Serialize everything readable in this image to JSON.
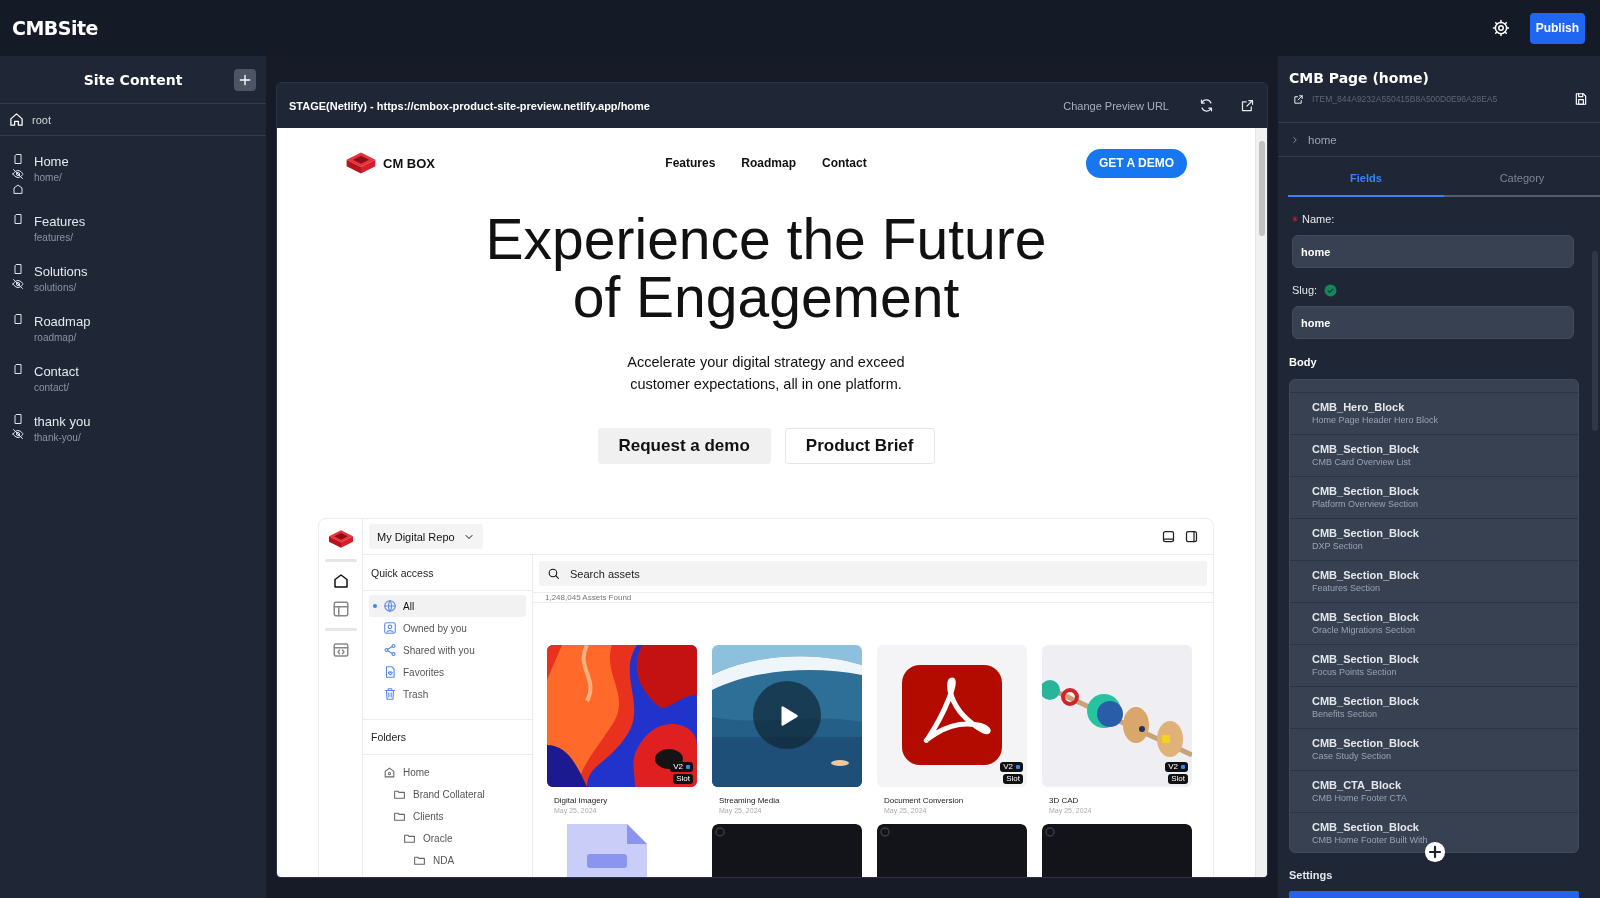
{
  "app": {
    "title": "CMBSite",
    "publish": "Publish"
  },
  "sidebar": {
    "title": "Site Content",
    "root": "root",
    "items": [
      {
        "name": "Home",
        "path": "home/",
        "hidden": true,
        "is_home": true
      },
      {
        "name": "Features",
        "path": "features/",
        "hidden": false,
        "is_home": false
      },
      {
        "name": "Solutions",
        "path": "solutions/",
        "hidden": true,
        "is_home": false
      },
      {
        "name": "Roadmap",
        "path": "roadmap/",
        "hidden": false,
        "is_home": false
      },
      {
        "name": "Contact",
        "path": "contact/",
        "hidden": false,
        "is_home": false
      },
      {
        "name": "thank you",
        "path": "thank-you/",
        "hidden": true,
        "is_home": false
      }
    ]
  },
  "preview": {
    "url_label": "STAGE(Netlify) - https://cmbox-product-site-preview.netlify.app/home",
    "change_url": "Change Preview URL",
    "site": {
      "brand": "CM BOX",
      "nav": [
        "Features",
        "Roadmap",
        "Contact"
      ],
      "cta": "GET A DEMO",
      "headline": "Experience the Future of Engagement",
      "subtext": "Accelerate your digital strategy and exceed customer expectations, all in one platform.",
      "buttons": [
        {
          "label": "Request a demo",
          "kind": "filled"
        },
        {
          "label": "Product Brief",
          "kind": "outline"
        }
      ],
      "mockup": {
        "repo": "My Digital Repo",
        "quick_access_title": "Quick access",
        "quick_access": [
          {
            "label": "All",
            "selected": true
          },
          {
            "label": "Owned by you",
            "selected": false
          },
          {
            "label": "Shared with you",
            "selected": false
          },
          {
            "label": "Favorites",
            "selected": false
          },
          {
            "label": "Trash",
            "selected": false
          }
        ],
        "folders_title": "Folders",
        "folders": [
          {
            "label": "Home",
            "kind": "home",
            "children": [
              {
                "label": "Brand Collateral",
                "kind": "folder"
              },
              {
                "label": "Clients",
                "kind": "folder",
                "children": [
                  {
                    "label": "Oracle",
                    "kind": "folder",
                    "children": [
                      {
                        "label": "NDA",
                        "kind": "folder"
                      }
                    ]
                  }
                ]
              }
            ]
          }
        ],
        "search_placeholder": "Search assets",
        "count": "1,248,045 Assets Found",
        "assets": [
          {
            "title": "Digital Imagery",
            "date": "May 25, 2024",
            "kind": "picture",
            "badges": [
              "V2",
              "Slot"
            ],
            "playable": false
          },
          {
            "title": "Streaming Media",
            "date": "May 25, 2024",
            "kind": "picture",
            "playable": true
          },
          {
            "title": "Document Conversion",
            "date": "May 25, 2024",
            "kind": "picture",
            "badges": [
              "V2",
              "Slot"
            ],
            "playable": false
          },
          {
            "title": "3D CAD",
            "date": "May 25, 2024",
            "kind": "picture",
            "badges": [
              "V2",
              "Slot"
            ],
            "playable": false
          },
          {
            "kind": "picture"
          },
          {
            "kind": "picture"
          },
          {
            "kind": "picture"
          },
          {
            "kind": "picture"
          }
        ]
      }
    }
  },
  "inspector": {
    "title": "CMB Page (home)",
    "item_id": "ITEM_844A9232A550415B8A500D0E96A28EA5",
    "breadcrumb": "home",
    "tabs": [
      {
        "label": "Fields",
        "selected": true
      },
      {
        "label": "Category",
        "selected": false
      }
    ],
    "fields": [
      {
        "label": "Name:",
        "value": "home",
        "required": true,
        "verified": false
      },
      {
        "label": "Slug:",
        "value": "home",
        "required": false,
        "verified": true
      }
    ],
    "body_title": "Body",
    "blocks": [
      {
        "name": "CMB_Hero_Block",
        "description": "Home Page Header Hero Block"
      },
      {
        "name": "CMB_Section_Block",
        "description": "CMB Card Overview List"
      },
      {
        "name": "CMB_Section_Block",
        "description": "Platform Overview Section"
      },
      {
        "name": "CMB_Section_Block",
        "description": "DXP Section"
      },
      {
        "name": "CMB_Section_Block",
        "description": "Features Section"
      },
      {
        "name": "CMB_Section_Block",
        "description": "Oracle Migrations Section"
      },
      {
        "name": "CMB_Section_Block",
        "description": "Focus Points Section"
      },
      {
        "name": "CMB_Section_Block",
        "description": "Benefits Section"
      },
      {
        "name": "CMB_Section_Block",
        "description": "Case Study Section"
      },
      {
        "name": "CMB_CTA_Block",
        "description": "CMB Home Footer CTA"
      },
      {
        "name": "CMB_Section_Block",
        "description": "CMB Home Footer Built With"
      }
    ],
    "settings_title": "Settings"
  }
}
